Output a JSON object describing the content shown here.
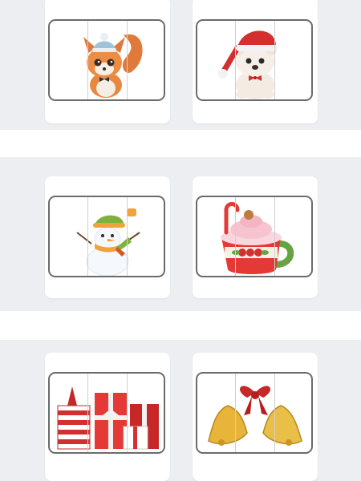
{
  "cards": [
    {
      "icon": "squirrel-icon"
    },
    {
      "icon": "santa-bear-icon"
    },
    {
      "icon": "snowman-icon"
    },
    {
      "icon": "cocoa-mug-icon"
    },
    {
      "icon": "gift-boxes-icon"
    },
    {
      "icon": "bells-icon"
    }
  ],
  "colors": {
    "band": "#eceef1",
    "card": "#ffffff",
    "frame_border": "#6b6b6b",
    "accent_red": "#d32f2f"
  }
}
